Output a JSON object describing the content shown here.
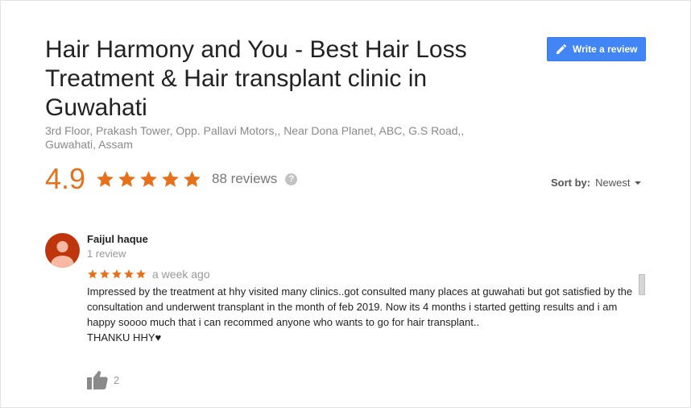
{
  "business": {
    "title": "Hair Harmony and You - Best Hair Loss Treatment & Hair transplant clinic in Guwahati",
    "address": "3rd Floor, Prakash Tower, Opp. Pallavi Motors,, Near Dona Planet, ABC, G.S Road,, Guwahati, Assam"
  },
  "write_review": {
    "label": "Write a review",
    "icon": "pencil-icon"
  },
  "rating": {
    "value": "4.9",
    "stars": 5,
    "reviews_label": "88 reviews",
    "help_glyph": "?",
    "star_color": "#e7711b"
  },
  "sort": {
    "label": "Sort by:",
    "value": "Newest"
  },
  "reviews": [
    {
      "name": "Faijul haque",
      "meta": "1 review",
      "stars": 5,
      "date": "a week ago",
      "text": "Impressed by the treatment at hhy visited many clinics..got consulted many places at guwahati but got satisfied by the consultation and underwent transplant in the month of feb 2019. Now its 4 months i started getting results and i am happy soooo much that i can recommed anyone who wants to go for hair transplant..",
      "signoff": "THANKU HHY♥",
      "likes": "2",
      "avatar_color": "#bf360c"
    }
  ],
  "colors": {
    "accent": "#4285f4",
    "rating": "#e7711b"
  }
}
